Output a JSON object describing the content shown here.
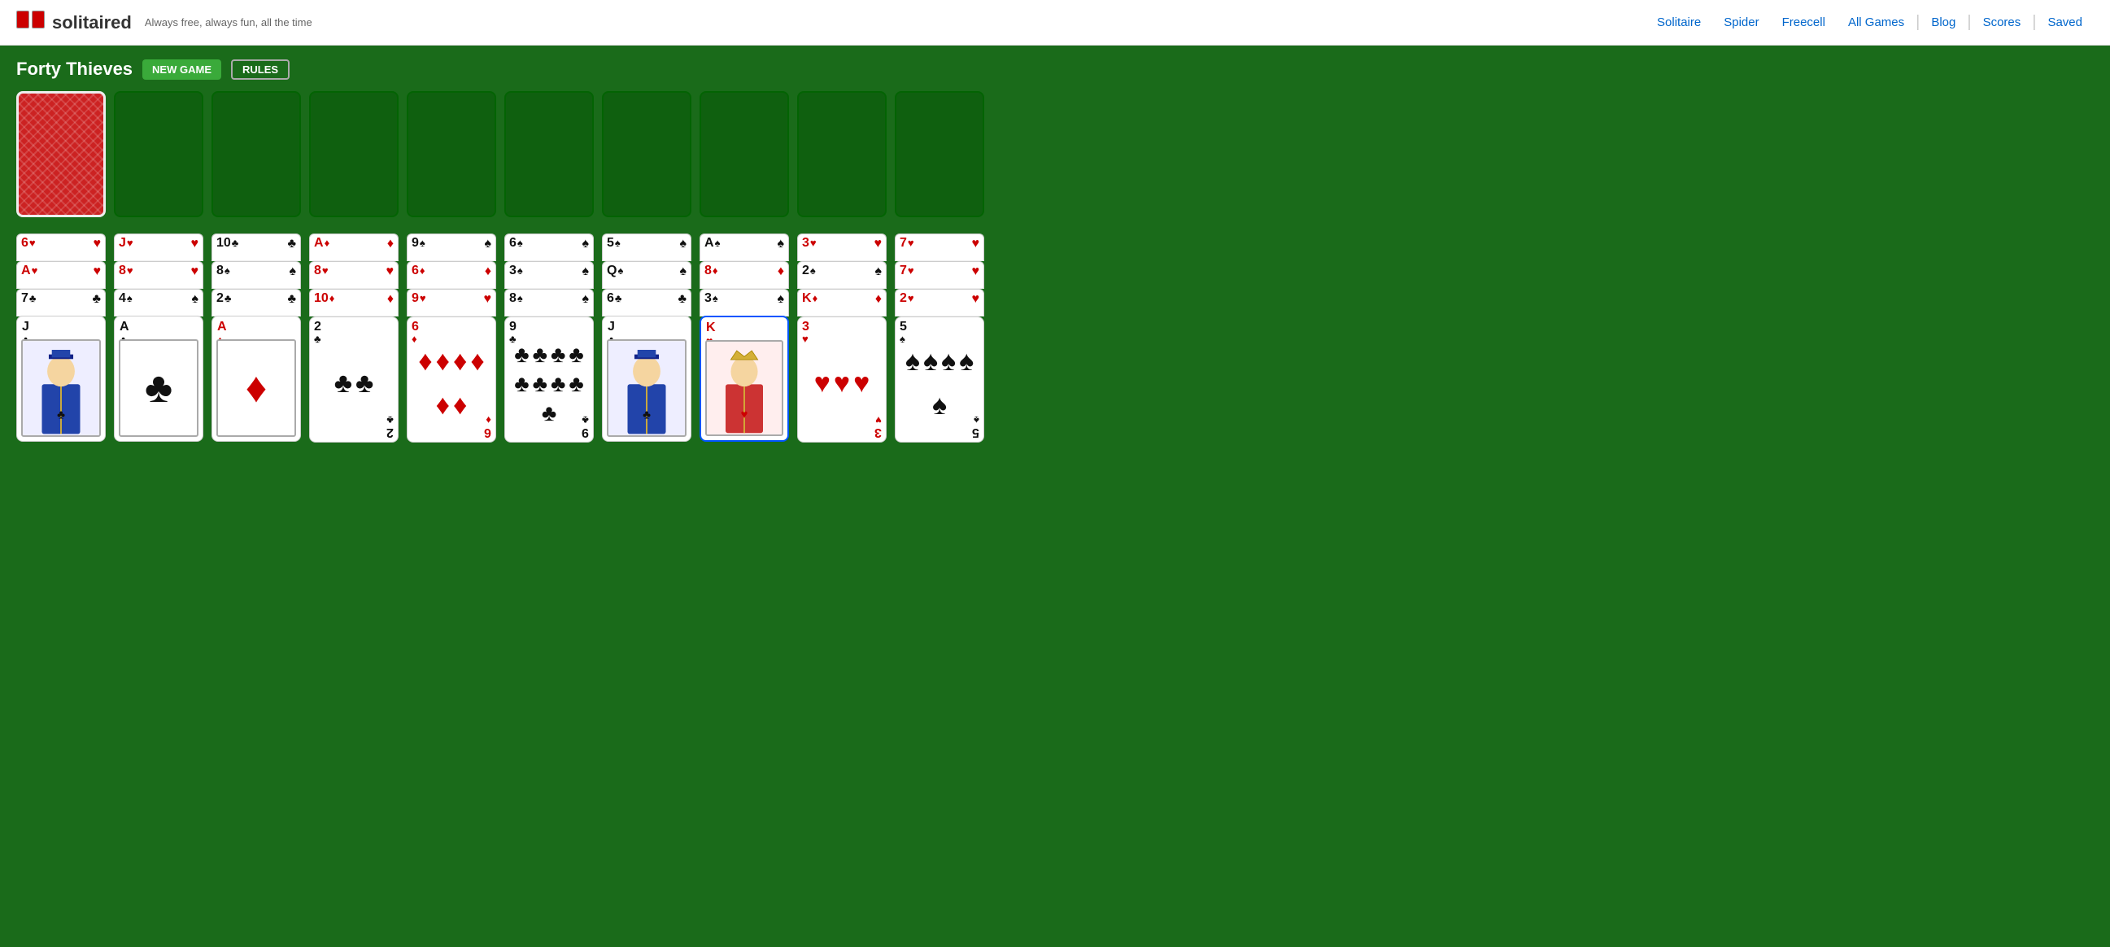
{
  "header": {
    "logo_text": "solitaired",
    "tagline": "Always free, always fun, all the time",
    "nav": [
      {
        "label": "Solitaire",
        "url": "#"
      },
      {
        "label": "Spider",
        "url": "#"
      },
      {
        "label": "Freecell",
        "url": "#"
      },
      {
        "label": "All Games",
        "url": "#"
      },
      {
        "label": "Blog",
        "url": "#"
      },
      {
        "label": "Scores",
        "url": "#"
      },
      {
        "label": "Saved",
        "url": "#"
      }
    ]
  },
  "game": {
    "title": "Forty Thieves",
    "new_game_label": "NEW GAME",
    "rules_label": "RULES"
  },
  "foundation_slots": 8,
  "tableau": [
    {
      "id": 0,
      "cards": [
        {
          "rank": "6",
          "suit": "♥",
          "color": "red"
        },
        {
          "rank": "A",
          "suit": "♥",
          "color": "red"
        },
        {
          "rank": "7",
          "suit": "♣",
          "color": "black"
        },
        {
          "rank": "J",
          "suit": "♣",
          "color": "black",
          "face": true
        }
      ]
    },
    {
      "id": 1,
      "cards": [
        {
          "rank": "J",
          "suit": "♥",
          "color": "red",
          "selected": true
        },
        {
          "rank": "8",
          "suit": "♥",
          "color": "red"
        },
        {
          "rank": "4",
          "suit": "♠",
          "color": "black"
        },
        {
          "rank": "A",
          "suit": "♣",
          "color": "black",
          "face": true
        }
      ]
    },
    {
      "id": 2,
      "cards": [
        {
          "rank": "10",
          "suit": "♣",
          "color": "black"
        },
        {
          "rank": "8",
          "suit": "♠",
          "color": "black"
        },
        {
          "rank": "2",
          "suit": "♣",
          "color": "black"
        },
        {
          "rank": "A",
          "suit": "♦",
          "color": "red",
          "face": true
        }
      ]
    },
    {
      "id": 3,
      "cards": [
        {
          "rank": "A",
          "suit": "♦",
          "color": "red"
        },
        {
          "rank": "8",
          "suit": "♥",
          "color": "red"
        },
        {
          "rank": "10",
          "suit": "♦",
          "color": "red"
        },
        {
          "rank": "2",
          "suit": "♣",
          "color": "black",
          "face": true
        }
      ]
    },
    {
      "id": 4,
      "cards": [
        {
          "rank": "9",
          "suit": "♠",
          "color": "black"
        },
        {
          "rank": "6",
          "suit": "♦",
          "color": "red"
        },
        {
          "rank": "9",
          "suit": "♥",
          "color": "red"
        },
        {
          "rank": "6",
          "suit": "♦",
          "color": "red",
          "face": true
        }
      ]
    },
    {
      "id": 5,
      "cards": [
        {
          "rank": "6",
          "suit": "♠",
          "color": "black"
        },
        {
          "rank": "3",
          "suit": "♠",
          "color": "black"
        },
        {
          "rank": "8",
          "suit": "♠",
          "color": "black"
        },
        {
          "rank": "9",
          "suit": "♣",
          "color": "black",
          "face": true
        }
      ]
    },
    {
      "id": 6,
      "cards": [
        {
          "rank": "5",
          "suit": "♠",
          "color": "black"
        },
        {
          "rank": "Q",
          "suit": "♠",
          "color": "black",
          "selected": true
        },
        {
          "rank": "6",
          "suit": "♣",
          "color": "black"
        },
        {
          "rank": "J",
          "suit": "♣",
          "color": "black",
          "face": true
        }
      ]
    },
    {
      "id": 7,
      "cards": [
        {
          "rank": "A",
          "suit": "♠",
          "color": "black"
        },
        {
          "rank": "8",
          "suit": "♦",
          "color": "red"
        },
        {
          "rank": "3",
          "suit": "♠",
          "color": "black"
        },
        {
          "rank": "K",
          "suit": "♥",
          "color": "red",
          "face": true,
          "selected": true
        }
      ]
    },
    {
      "id": 8,
      "cards": [
        {
          "rank": "3",
          "suit": "♥",
          "color": "red"
        },
        {
          "rank": "2",
          "suit": "♠",
          "color": "black"
        },
        {
          "rank": "K",
          "suit": "♦",
          "color": "red",
          "selected": true
        },
        {
          "rank": "3",
          "suit": "♥",
          "color": "red",
          "face": true
        }
      ]
    },
    {
      "id": 9,
      "cards": [
        {
          "rank": "7",
          "suit": "♥",
          "color": "red"
        },
        {
          "rank": "7",
          "suit": "♥",
          "color": "red"
        },
        {
          "rank": "2",
          "suit": "♥",
          "color": "red"
        },
        {
          "rank": "5",
          "suit": "♠",
          "color": "black",
          "face": true
        }
      ]
    }
  ]
}
